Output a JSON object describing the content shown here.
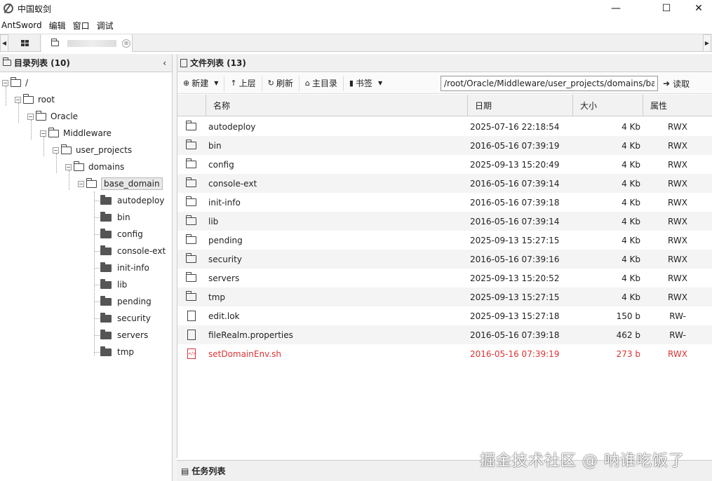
{
  "window": {
    "title": "中国蚁剑",
    "controls": {
      "minimize": "—",
      "maximize": "☐",
      "close": "✕"
    }
  },
  "menu": {
    "items": [
      "AntSword",
      "编辑",
      "窗口",
      "调试"
    ]
  },
  "tabs": {
    "left_arrow": "◀",
    "right_arrow": "▶",
    "session_close": "⊗"
  },
  "dir_panel": {
    "title": "目录列表 (10)",
    "collapse": "‹",
    "tree": [
      {
        "label": "/",
        "toggle": "−"
      },
      {
        "label": "root",
        "toggle": "−"
      },
      {
        "label": "Oracle",
        "toggle": "−"
      },
      {
        "label": "Middleware",
        "toggle": "−"
      },
      {
        "label": "user_projects",
        "toggle": "−"
      },
      {
        "label": "domains",
        "toggle": "−"
      },
      {
        "label": "base_domain",
        "toggle": "−"
      }
    ],
    "children": [
      "autodeploy",
      "bin",
      "config",
      "console-ext",
      "init-info",
      "lib",
      "pending",
      "security",
      "servers",
      "tmp"
    ]
  },
  "file_panel": {
    "title": "文件列表 (13)",
    "toolbar": {
      "new_label": "新建",
      "up_label": "上层",
      "refresh_label": "刷新",
      "home_label": "主目录",
      "bookmark_label": "书签",
      "path_value": "/root/Oracle/Middleware/user_projects/domains/base_domain/",
      "read_label": "读取"
    },
    "columns": {
      "name": "名称",
      "date": "日期",
      "size": "大小",
      "attr": "属性"
    },
    "rows": [
      {
        "type": "folder",
        "name": "autodeploy",
        "date": "2025-07-16 22:18:54",
        "size": "4 Kb",
        "attr": "RWX"
      },
      {
        "type": "folder",
        "name": "bin",
        "date": "2016-05-16 07:39:19",
        "size": "4 Kb",
        "attr": "RWX"
      },
      {
        "type": "folder",
        "name": "config",
        "date": "2025-09-13 15:20:49",
        "size": "4 Kb",
        "attr": "RWX"
      },
      {
        "type": "folder",
        "name": "console-ext",
        "date": "2016-05-16 07:39:14",
        "size": "4 Kb",
        "attr": "RWX"
      },
      {
        "type": "folder",
        "name": "init-info",
        "date": "2016-05-16 07:39:18",
        "size": "4 Kb",
        "attr": "RWX"
      },
      {
        "type": "folder",
        "name": "lib",
        "date": "2016-05-16 07:39:14",
        "size": "4 Kb",
        "attr": "RWX"
      },
      {
        "type": "folder",
        "name": "pending",
        "date": "2025-09-13 15:27:15",
        "size": "4 Kb",
        "attr": "RWX"
      },
      {
        "type": "folder",
        "name": "security",
        "date": "2016-05-16 07:39:16",
        "size": "4 Kb",
        "attr": "RWX"
      },
      {
        "type": "folder",
        "name": "servers",
        "date": "2025-09-13 15:20:52",
        "size": "4 Kb",
        "attr": "RWX"
      },
      {
        "type": "folder",
        "name": "tmp",
        "date": "2025-09-13 15:27:15",
        "size": "4 Kb",
        "attr": "RWX"
      },
      {
        "type": "file",
        "name": "edit.lok",
        "date": "2025-09-13 15:27:18",
        "size": "150 b",
        "attr": "RW-"
      },
      {
        "type": "file",
        "name": "fileRealm.properties",
        "date": "2016-05-16 07:39:18",
        "size": "462 b",
        "attr": "RW-"
      },
      {
        "type": "script",
        "name": "setDomainEnv.sh",
        "date": "2016-05-16 07:39:19",
        "size": "273 b",
        "attr": "RWX"
      }
    ]
  },
  "task_panel": {
    "title": "任务列表"
  },
  "watermark": "掘金技术社区 @ 呐谁吃饭了"
}
